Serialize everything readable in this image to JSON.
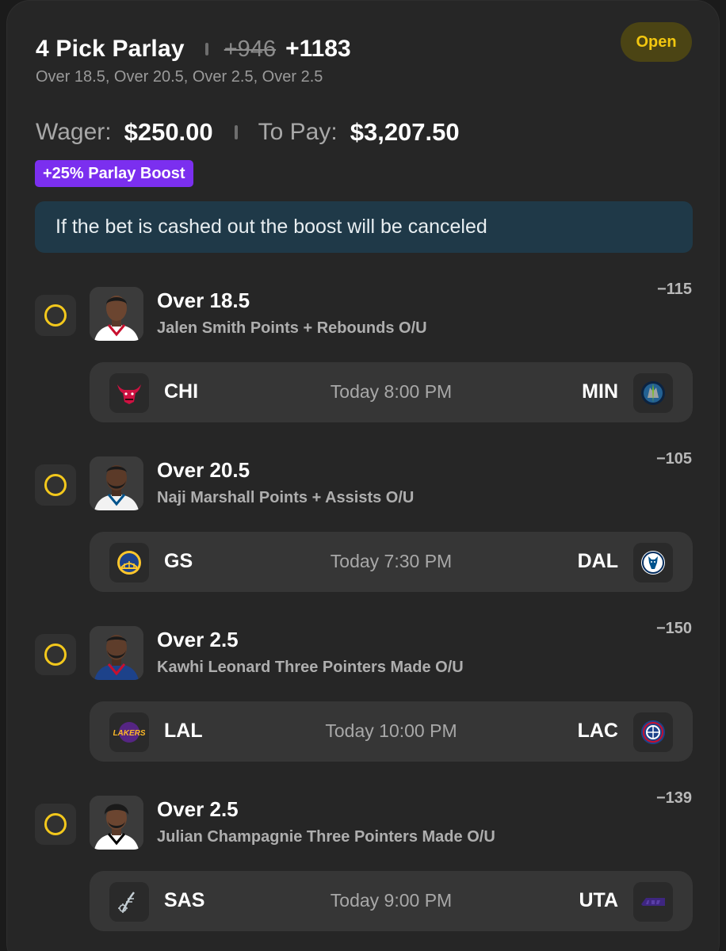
{
  "parlay": {
    "title": "4 Pick Parlay",
    "old_odds": "+946",
    "new_odds": "+1183",
    "selections_summary": "Over 18.5, Over 20.5, Over 2.5, Over 2.5",
    "status": "Open"
  },
  "wager": {
    "wager_label": "Wager:",
    "wager_value": "$250.00",
    "payout_label": "To Pay:",
    "payout_value": "$3,207.50"
  },
  "boost": {
    "label": "+25% Parlay Boost"
  },
  "notice": {
    "text": "If the bet is cashed out the boost will be canceled"
  },
  "legs": [
    {
      "pick": "Over 18.5",
      "market": "Jalen Smith Points + Rebounds O/U",
      "odds": "−115",
      "home_team": "CHI",
      "time": "Today 8:00 PM",
      "away_team": "MIN",
      "home_logo": "bulls-icon",
      "away_logo": "timberwolves-icon",
      "jersey_color": "#ffffff"
    },
    {
      "pick": "Over 20.5",
      "market": "Naji Marshall Points + Assists O/U",
      "odds": "−105",
      "home_team": "GS",
      "time": "Today 7:30 PM",
      "away_team": "DAL",
      "home_logo": "warriors-icon",
      "away_logo": "mavericks-icon",
      "jersey_color": "#f2f2f2"
    },
    {
      "pick": "Over 2.5",
      "market": "Kawhi Leonard Three Pointers Made O/U",
      "odds": "−150",
      "home_team": "LAL",
      "time": "Today 10:00 PM",
      "away_team": "LAC",
      "home_logo": "lakers-icon",
      "away_logo": "clippers-icon",
      "jersey_color": "#1d428a"
    },
    {
      "pick": "Over 2.5",
      "market": "Julian Champagnie Three Pointers Made O/U",
      "odds": "−139",
      "home_team": "SAS",
      "time": "Today 9:00 PM",
      "away_team": "UTA",
      "home_logo": "spurs-icon",
      "away_logo": "jazz-icon",
      "jersey_color": "#ffffff"
    }
  ],
  "colors": {
    "card_bg": "#262626",
    "status_bg": "#4b4414",
    "status_text": "#f2c70f",
    "boost_bg": "#7b2fef",
    "notice_bg": "#1f3948",
    "radio": "#f3c81c"
  }
}
